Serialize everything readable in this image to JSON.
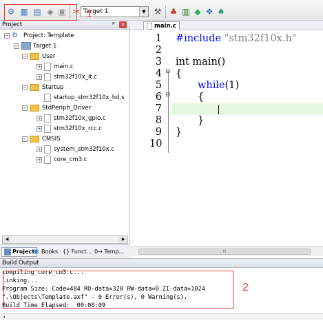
{
  "toolbar": {
    "target": "Target 1",
    "annotation": "1"
  },
  "project_panel": {
    "title": "Project",
    "pin": "ᵖ",
    "close": "✕",
    "tree": [
      {
        "label": "Project: Template"
      },
      {
        "label": "Target 1"
      },
      {
        "label": "User"
      },
      {
        "label": "main.c"
      },
      {
        "label": "stm32f10x_it.c"
      },
      {
        "label": "Startup"
      },
      {
        "label": "startup_stm32f10x_hd.s"
      },
      {
        "label": "StdPeriph_Driver"
      },
      {
        "label": "stm32f10x_gpio.c"
      },
      {
        "label": "stm32f10x_rcc.c"
      },
      {
        "label": "CMSIS"
      },
      {
        "label": "system_stm32f10x.c"
      },
      {
        "label": "core_cm3.c"
      }
    ],
    "tabs": [
      "Project",
      "Books",
      "{} Funct...",
      "0→ Temp..."
    ]
  },
  "editor": {
    "tab": "main.c",
    "lines": [
      {
        "n": "1",
        "include_kw": "#include",
        "include_str": "\"stm32f10x.h\""
      },
      {
        "n": "2"
      },
      {
        "n": "3",
        "text": "int main()"
      },
      {
        "n": "4",
        "text": "{"
      },
      {
        "n": "5",
        "kw": "while",
        "rest": "(1)"
      },
      {
        "n": "6",
        "text": "{"
      },
      {
        "n": "7"
      },
      {
        "n": "8",
        "text": "}"
      },
      {
        "n": "9",
        "text": "}"
      },
      {
        "n": "10"
      }
    ],
    "scroll_label": "III"
  },
  "build_output": {
    "title": "Build Output",
    "lines": [
      "compiling core_cm3.c...",
      "linking...",
      "Program Size: Code=484 RO-data=320 RW-data=0 ZI-data=1024",
      "\".\\Objects\\Template.axf\" - 0 Error(s), 0 Warning(s).",
      "Build Time Elapsed:  00:00:09"
    ],
    "annotation": "2"
  }
}
